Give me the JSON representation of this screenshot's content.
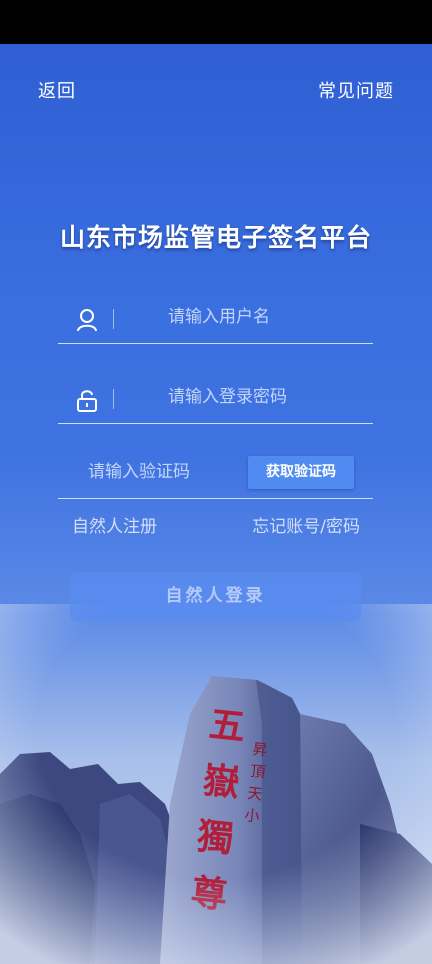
{
  "header": {
    "back_label": "返回",
    "faq_label": "常见问题"
  },
  "title": "山东市场监管电子签名平台",
  "form": {
    "username_placeholder": "请输入用户名",
    "password_placeholder": "请输入登录密码",
    "code_placeholder": "请输入验证码",
    "get_code_label": "获取验证码"
  },
  "links": {
    "register_label": "自然人注册",
    "forget_label": "忘记账号/密码"
  },
  "login_button_label": "自然人登录",
  "background": {
    "stele_text": "五嶽獨尊",
    "stele_small_text": "昇頂天小"
  },
  "colors": {
    "accent": "#4f8bf0",
    "background_top": "#2f5fd3"
  }
}
